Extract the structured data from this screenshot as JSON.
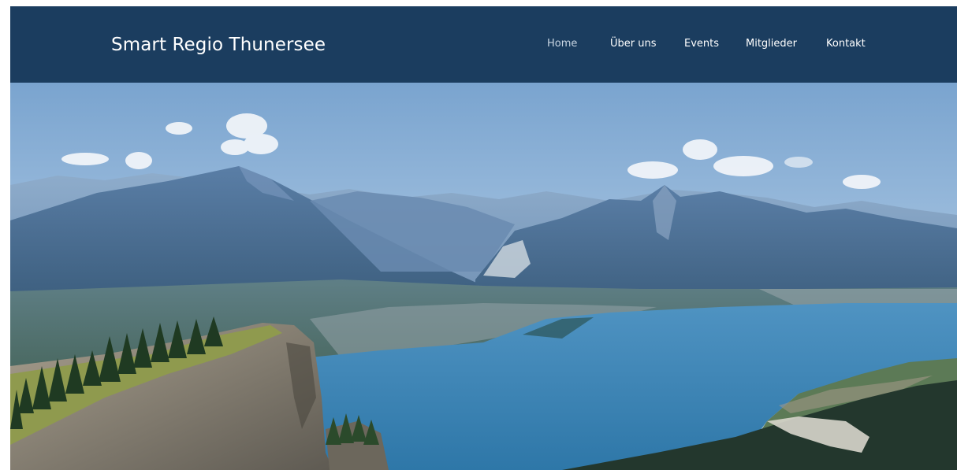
{
  "header": {
    "site_title": "Smart Regio Thunersee"
  },
  "nav": {
    "items": [
      {
        "label": "Home",
        "active": true
      },
      {
        "label": "Über uns",
        "active": false
      },
      {
        "label": "Events",
        "active": false
      },
      {
        "label": "Mitglieder",
        "active": false
      },
      {
        "label": "Kontakt",
        "active": false
      }
    ]
  },
  "colors": {
    "header_bg": "#1b3d5f",
    "nav_text": "#ffffff",
    "nav_active": "#c9d6e3"
  }
}
